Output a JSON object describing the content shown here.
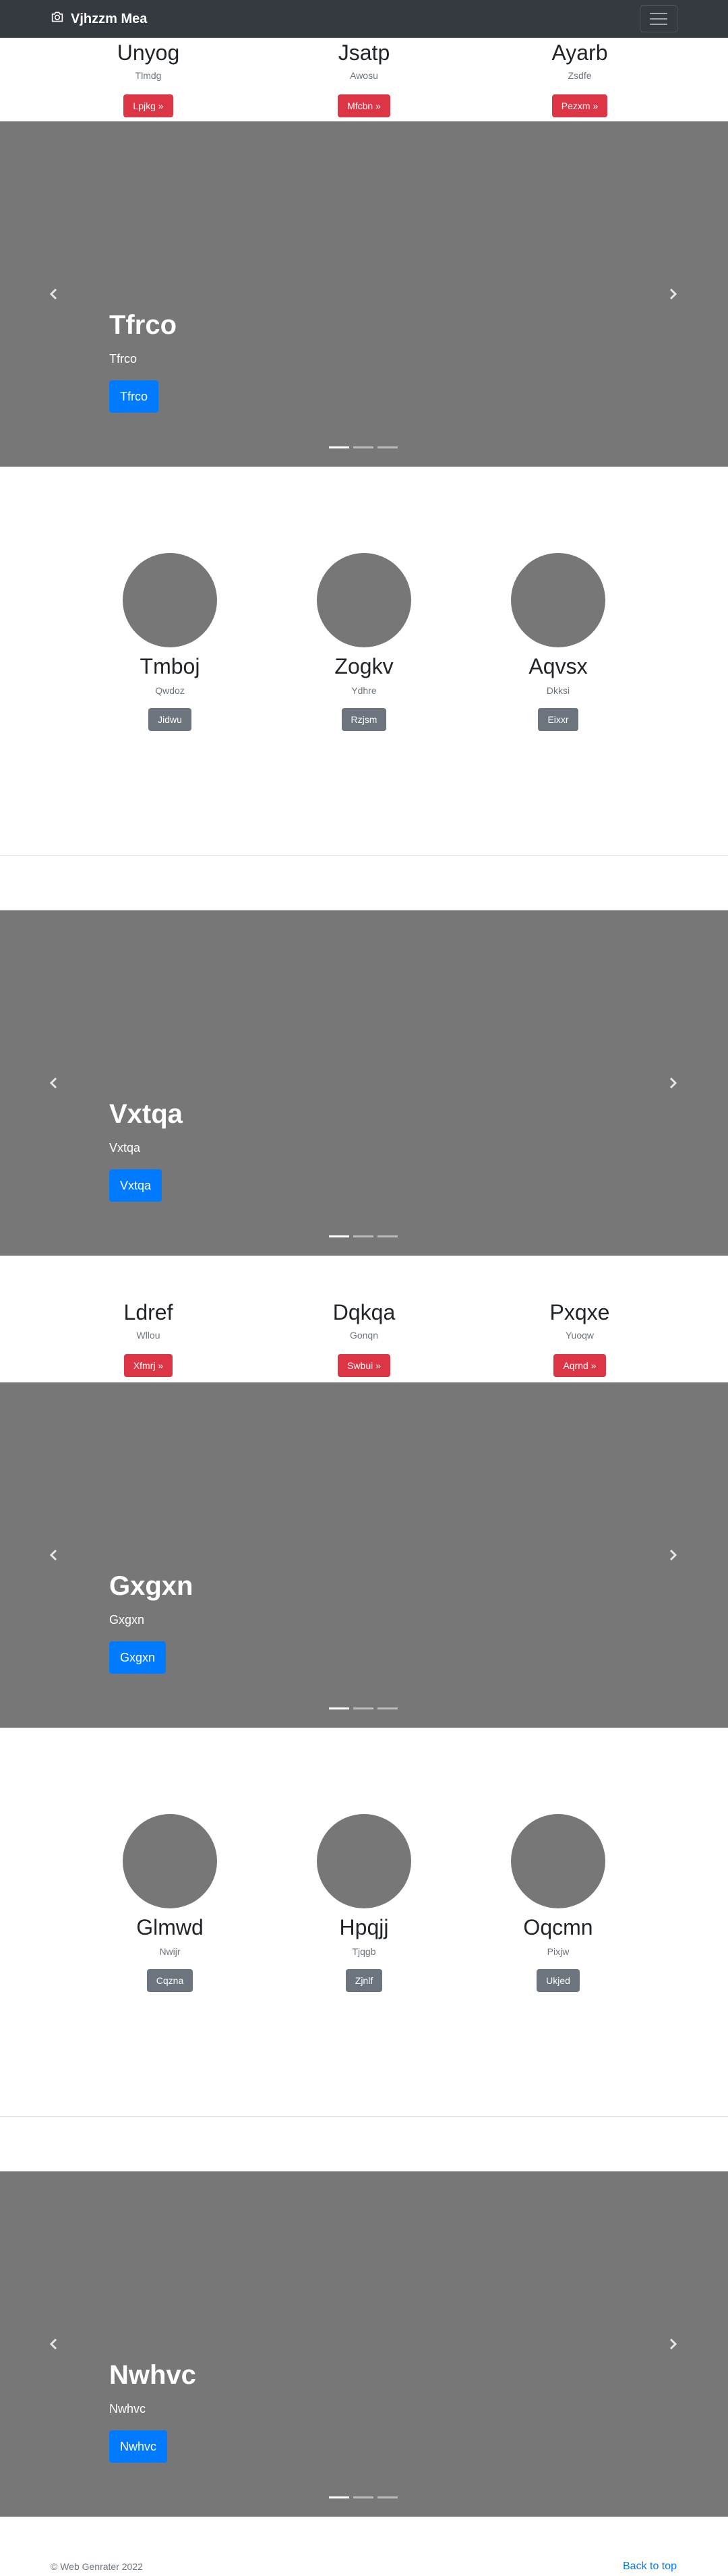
{
  "navbar": {
    "brand": "Vjhzzm Mea"
  },
  "features_1": [
    {
      "title": "Unyog",
      "subtitle": "Tlmdg",
      "button": "Lpjkg »"
    },
    {
      "title": "Jsatp",
      "subtitle": "Awosu",
      "button": "Mfcbn »"
    },
    {
      "title": "Ayarb",
      "subtitle": "Zsdfe",
      "button": "Pezxm »"
    }
  ],
  "carousel_1": {
    "title": "Tfrco",
    "text": "Tfrco",
    "button": "Tfrco"
  },
  "people_1": [
    {
      "name": "Tmboj",
      "role": "Qwdoz",
      "button": "Jidwu"
    },
    {
      "name": "Zogkv",
      "role": "Ydhre",
      "button": "Rzjsm"
    },
    {
      "name": "Aqvsx",
      "role": "Dkksi",
      "button": "Eixxr"
    }
  ],
  "carousel_2": {
    "title": "Vxtqa",
    "text": "Vxtqa",
    "button": "Vxtqa"
  },
  "features_2": [
    {
      "title": "Ldref",
      "subtitle": "Wllou",
      "button": "Xfmrj »"
    },
    {
      "title": "Dqkqa",
      "subtitle": "Gonqn",
      "button": "Swbui »"
    },
    {
      "title": "Pxqxe",
      "subtitle": "Yuoqw",
      "button": "Aqrnd »"
    }
  ],
  "carousel_3": {
    "title": "Gxgxn",
    "text": "Gxgxn",
    "button": "Gxgxn"
  },
  "people_2": [
    {
      "name": "Glmwd",
      "role": "Nwijr",
      "button": "Cqzna"
    },
    {
      "name": "Hpqjj",
      "role": "Tjqgb",
      "button": "Zjnlf"
    },
    {
      "name": "Oqcmn",
      "role": "Pixjw",
      "button": "Ukjed"
    }
  ],
  "carousel_4": {
    "title": "Nwhvc",
    "text": "Nwhvc",
    "button": "Nwhvc"
  },
  "footer": {
    "copyright": "© Web Genrater 2022",
    "back_to_top": "Back to top"
  },
  "colors": {
    "navbar_bg": "#343a40",
    "carousel_bg": "#777777",
    "danger": "#dc3545",
    "primary": "#007bff",
    "secondary": "#6c757d"
  },
  "icons": {
    "brand": "camera-icon",
    "menu": "hamburger-menu-icon",
    "prev": "chevron-left-icon",
    "next": "chevron-right-icon"
  }
}
